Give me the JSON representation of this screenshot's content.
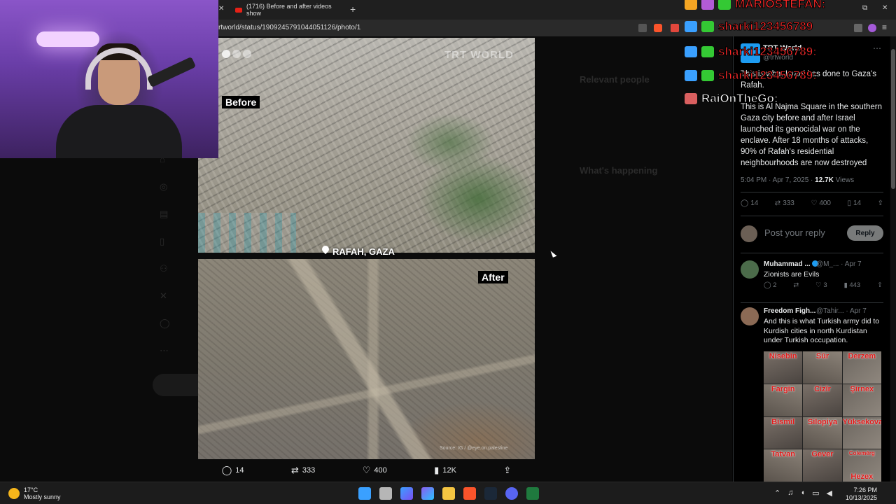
{
  "browser": {
    "tab_title": "(1716) Before and after videos show",
    "url": "rtworld/status/1909245791044051126/photo/1"
  },
  "media": {
    "label_before": "Before",
    "label_after": "After",
    "location": "RAFAH, GAZA",
    "watermark": "TRT WORLD",
    "source": "Source: IG / @eye.on.palestine",
    "actions": {
      "replies": "14",
      "reposts": "333",
      "likes": "400",
      "views": "12K"
    }
  },
  "tweet": {
    "author_name": "TRT World",
    "author_handle": "@trtworld",
    "headline": "This is what Israel has done to Gaza's Rafah.",
    "body": "This is Al Najma Square in the southern Gaza city before and after Israel launched its genocidal war on the enclave. After 18 months of attacks, 90% of Rafah's residential neighbourhoods are now destroyed",
    "timestamp": "5:04 PM · Apr 7, 2025 · ",
    "views_count": "12.7K",
    "views_label": " Views",
    "stats": {
      "replies": "14",
      "reposts": "333",
      "likes": "400",
      "bookmarks": "14"
    },
    "reply_placeholder": "Post your reply",
    "reply_button": "Reply"
  },
  "replies": [
    {
      "name": "Muhammad ...",
      "handle": "@M_... · Apr 7",
      "text": "Zionists are Evils",
      "replies": "2",
      "reposts": "",
      "likes": "3",
      "views": "443"
    },
    {
      "name": "Freedom Figh...",
      "handle": "@Tahir... · Apr 7",
      "text": "And this is what Turkish army did to Kurdish cities in north Kurdistan under Turkish occupation.",
      "image_labels": [
        "Nisebin",
        "Sûr",
        "Derzem",
        "Fargin",
        "Cizîr",
        "Şirnex",
        "Bismil",
        "Silopiya",
        "Yüksekova",
        "Tatvan",
        "Gever",
        "Colemêrg",
        "Hezex"
      ]
    }
  ],
  "background_page": {
    "relevant_people": "Relevant people",
    "whats_happening": "What's happening"
  },
  "chat": [
    {
      "name": "MARIOSTEFAN:",
      "color": "#ff2a2a"
    },
    {
      "name": "sharki123456789",
      "color": "#ff2a2a"
    },
    {
      "name": "sharki123456789:",
      "color": "#ff2a2a"
    },
    {
      "name": "sharki123456789:",
      "color": "#ff2a2a"
    },
    {
      "name": "RaiOnTheGo:",
      "color": "#ffffff"
    }
  ],
  "taskbar": {
    "temperature": "17°C",
    "weather": "Mostly sunny",
    "time": "7:26 PM",
    "date": "10/13/2025"
  },
  "colors": {
    "accent": "#1d9bf0",
    "chat_red": "#ff2a2a",
    "stream_purple": "#8a55c8"
  }
}
